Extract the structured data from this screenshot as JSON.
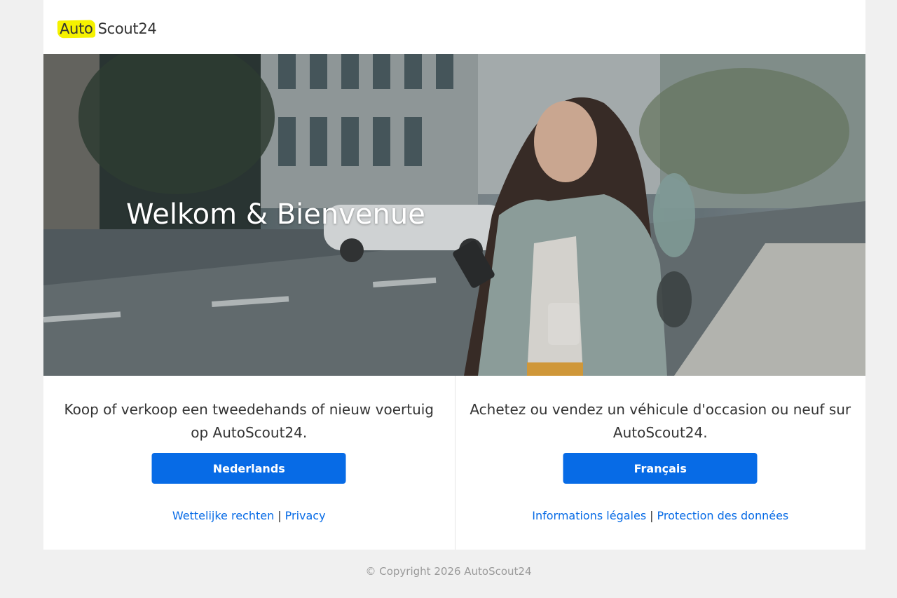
{
  "logo": {
    "part1": "Auto",
    "part2": "Scout24"
  },
  "hero": {
    "title": "Welkom & Bienvenue"
  },
  "nl": {
    "text": "Koop of verkoop een tweedehands of nieuw voertuig op AutoScout24.",
    "button": "Nederlands",
    "link1": "Wettelijke rechten",
    "separator": "|",
    "link2": "Privacy"
  },
  "fr": {
    "text": "Achetez ou vendez un véhicule d'occasion ou neuf sur AutoScout24.",
    "button": "Français",
    "link1": "Informations légales",
    "separator": "|",
    "link2": "Protection des données"
  },
  "footer": {
    "copyright": "© Copyright 2026 AutoScout24"
  },
  "colors": {
    "accent": "#076be6",
    "logo_yellow": "#f5f200",
    "background": "#f0f0f0"
  }
}
